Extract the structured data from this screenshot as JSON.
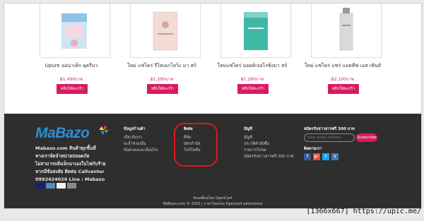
{
  "products": [
    {
      "name": "Upure ออน่าเด็ก ผุดรีบว",
      "price": "฿1,490บาท",
      "button": "หยิบใส่ตะกร้า"
    },
    {
      "name": "ใหม่ แช่ไคร่ รีไทเอกไลวิ่ง มา สก์",
      "price": "฿1,290บาท",
      "button": "หยิบใส่ตะกร้า"
    },
    {
      "name": "ใหม่แช่ไคร่ มอยต์เจอไรซิ่งมา สก์",
      "price": "฿1,290บาท",
      "button": "หยิบใส่ตะกร้า"
    },
    {
      "name": "ใหม่ แช่ไคร่ แซร่ แอคทีฟ เอส เซ้นส์",
      "price": "฿2,100บาท",
      "button": "หยิบใส่ตะกร้า"
    }
  ],
  "footer": {
    "logo": "MaBazo",
    "about_line1": "Mabazo.com สินค้าทุกชิ้นที่",
    "about_line2": "ทางเราจัดจำหน่ายปลอดภัย",
    "about_line3": "ไม่สามารถสั่งเล็กมาเองในไฟกับร้าย",
    "about_line4": "หากมีข้อสงสัย ติดต่อ Callcenter",
    "about_line5": "0992424020 Line : Mabazo",
    "col1": {
      "heading": "ข้อมูลร้านค้า",
      "links": [
        "เกี่ยวกับเรา",
        "จะจ้ำช่วยเป็น",
        "ข้อตกลงและเงื่อนไข"
      ]
    },
    "col2": {
      "heading": "พิเศษ",
      "links": [
        "ยี่ห้อ",
        "บัตรกำนัล",
        "โปรโมชั่น"
      ]
    },
    "col3": {
      "heading": "บัญชี",
      "links": [
        "บัญชี",
        "ประวัติคำสั่งซื้อ",
        "รายการโปรด",
        "สมัครรับข่าวสารฟรี 200 บาท"
      ]
    },
    "newsletter": {
      "heading": "สมัครรับข่าวสารฟรี 200 บาท",
      "placeholder": "your email address",
      "button": "Subscribe",
      "follow": "ติดตามเรา"
    },
    "social": [
      {
        "name": "facebook",
        "glyph": "f",
        "color": "#3b5998"
      },
      {
        "name": "google-plus",
        "glyph": "g+",
        "color": "#dd4b39"
      },
      {
        "name": "twitter",
        "glyph": "t",
        "color": "#1da1f2"
      },
      {
        "name": "vk",
        "glyph": "v",
        "color": "#4a76a8"
      }
    ],
    "powered_line1": "ขับเคลื่อนโดย OpenCart",
    "powered_line2": "MaBazo.com © 2015 | ภาษาไทยโดย Opencart extensions"
  },
  "watermark": "[1366x667] https://upic.me/",
  "colors": {
    "accent": "#d81b60",
    "footer_bg": "#2e2e2e",
    "logo": "#2b8fd6",
    "highlight": "#e0161c"
  }
}
